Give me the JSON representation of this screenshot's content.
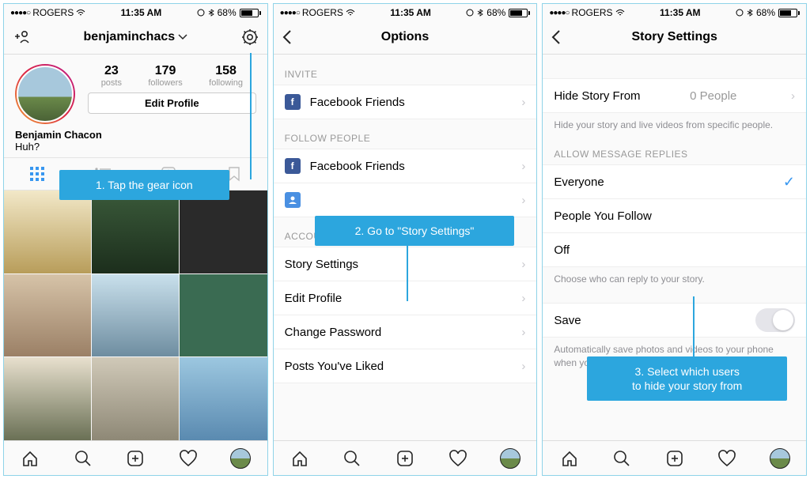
{
  "statusbar": {
    "carrier": "ROGERS",
    "time": "11:35 AM",
    "battery_pct": "68%"
  },
  "screen1": {
    "username": "benjaminchacs",
    "stats": {
      "posts_num": "23",
      "posts_lab": "posts",
      "followers_num": "179",
      "followers_lab": "followers",
      "following_num": "158",
      "following_lab": "following"
    },
    "edit_profile": "Edit Profile",
    "display_name": "Benjamin Chacon",
    "bio_text": "Huh?",
    "callout1": "1. Tap the gear icon"
  },
  "screen2": {
    "title": "Options",
    "invite_hdr": "INVITE",
    "fb_friends": "Facebook Friends",
    "follow_hdr": "FOLLOW PEOPLE",
    "account_hdr": "ACCOUNT",
    "story_settings": "Story Settings",
    "edit_profile": "Edit Profile",
    "change_password": "Change Password",
    "posts_liked": "Posts You've Liked",
    "callout2": "2. Go to \"Story Settings\""
  },
  "screen3": {
    "title": "Story Settings",
    "hide_from": "Hide Story From",
    "hide_from_val": "0 People",
    "hide_footer": "Hide your story and live videos from specific people.",
    "allow_hdr": "ALLOW MESSAGE REPLIES",
    "everyone": "Everyone",
    "people_follow": "People You Follow",
    "off": "Off",
    "choose_footer": "Choose who can reply to your story.",
    "save": "Save",
    "save_footer": "Automatically save photos and videos to your phone when you add them to your story.",
    "callout3_l1": "3. Select which users",
    "callout3_l2": "to hide your story from"
  }
}
